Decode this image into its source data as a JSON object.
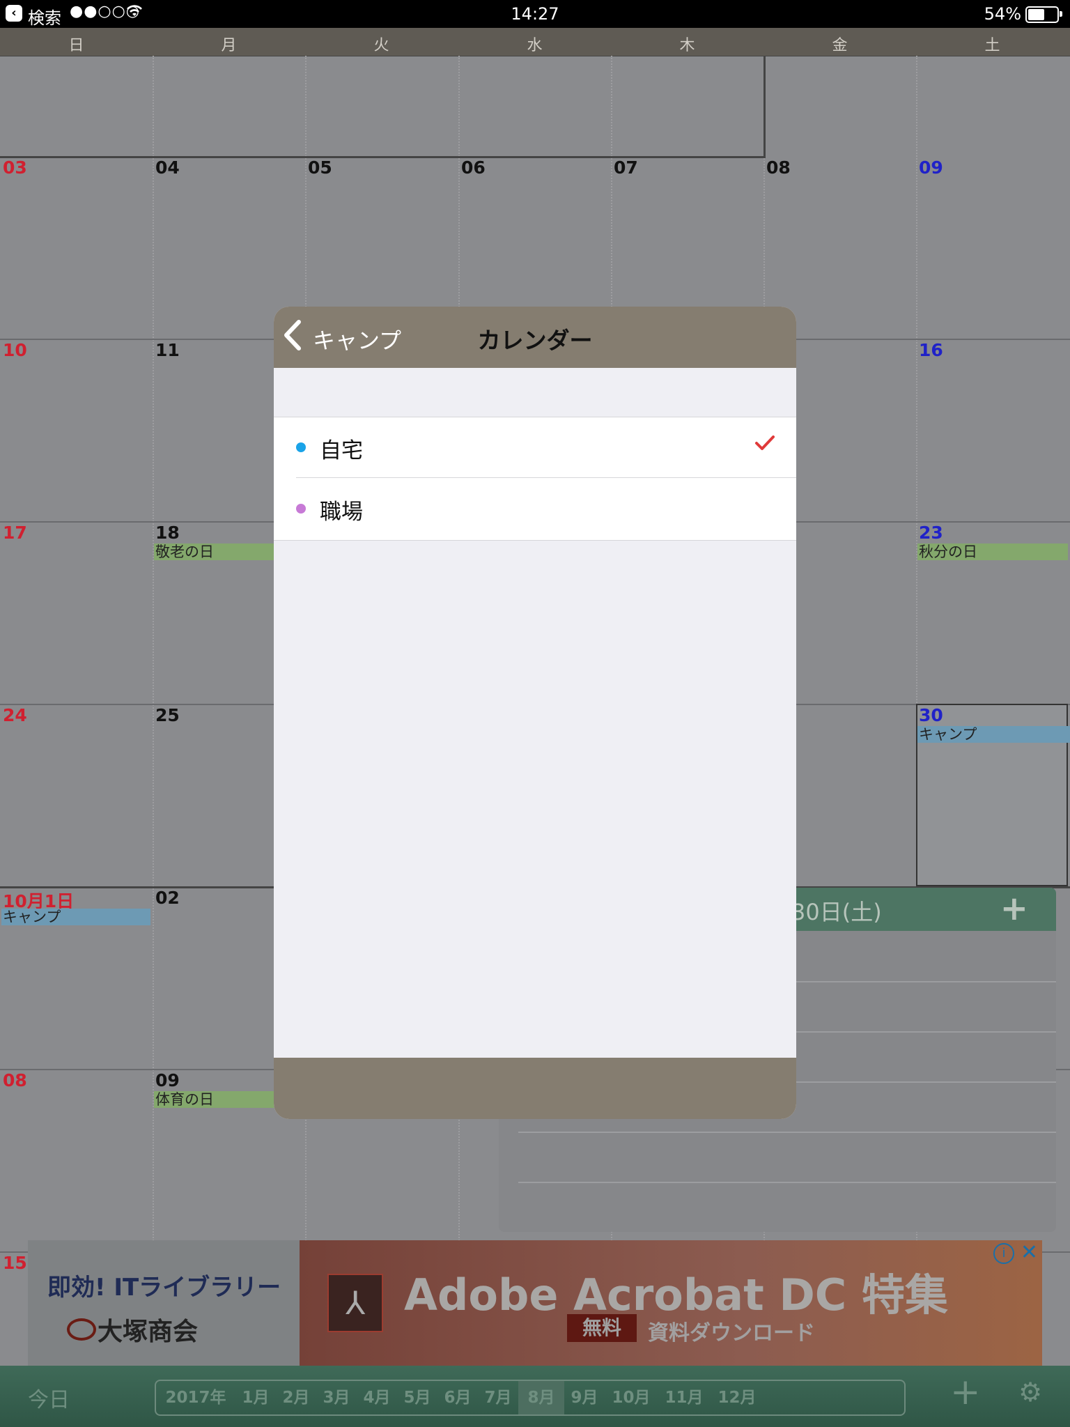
{
  "status_bar": {
    "back_label": "検索",
    "signal": "●●○○○",
    "time": "14:27",
    "battery": "54%",
    "wifi_icon": "wifi-icon"
  },
  "weekdays": [
    "日",
    "月",
    "火",
    "水",
    "木",
    "金",
    "土"
  ],
  "calendar": {
    "row2": [
      "03",
      "04",
      "05",
      "06",
      "07",
      "08",
      "09"
    ],
    "row3": [
      "10",
      "11",
      "16"
    ],
    "row4": [
      "17",
      "18",
      "23"
    ],
    "row5": [
      "24",
      "25",
      "30"
    ],
    "row6": [
      "10月1日",
      "02"
    ],
    "row7": [
      "08",
      "09"
    ],
    "row8": [
      "15"
    ],
    "events": {
      "keirou": "敬老の日",
      "shubun": "秋分の日",
      "camp": "キャンプ",
      "taiiku": "体育の日"
    }
  },
  "detail_panel": {
    "title": "30日(土)",
    "add": "+"
  },
  "ad": {
    "logo_line1": "即効! ITライブラリー",
    "logo_line2": "大塚商会",
    "title": "Adobe Acrobat DC 特集",
    "free": "無料",
    "subtitle": "資料ダウンロード",
    "info": "i",
    "close": "✕"
  },
  "toolbar": {
    "today": "今日",
    "months": [
      "2017年",
      "1月",
      "2月",
      "3月",
      "4月",
      "5月",
      "6月",
      "7月",
      "8月",
      "9月",
      "10月",
      "11月",
      "12月"
    ],
    "selected_month": "8月"
  },
  "modal": {
    "back_label": "キャンプ",
    "title": "カレンダー",
    "calendars": [
      {
        "name": "自宅",
        "color": "#1aa3e8",
        "checked": true
      },
      {
        "name": "職場",
        "color": "#c77ad6",
        "checked": false
      }
    ],
    "checkmark": "✓"
  }
}
